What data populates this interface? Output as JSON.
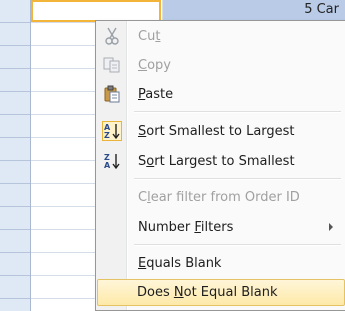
{
  "datasheet": {
    "first_row_value": "5 Car"
  },
  "context_menu": {
    "items": [
      {
        "label": "Cut",
        "icon": "scissors-icon",
        "enabled": false
      },
      {
        "label": "Copy",
        "icon": "copy-icon",
        "enabled": false
      },
      {
        "label": "Paste",
        "icon": "clipboard-icon",
        "enabled": true
      },
      {
        "label": "Sort Smallest to Largest",
        "icon": "sort-ascending-icon",
        "enabled": true
      },
      {
        "label": "Sort Largest to Smallest",
        "icon": "sort-descending-icon",
        "enabled": true
      },
      {
        "label": "Clear filter from Order ID",
        "icon": "",
        "enabled": false
      },
      {
        "label": "Number Filters",
        "icon": "chevron-right-icon",
        "enabled": true
      },
      {
        "label": "Equals Blank",
        "icon": "",
        "enabled": true
      },
      {
        "label": "Does Not Equal Blank",
        "icon": "",
        "enabled": true,
        "highlighted": true
      }
    ]
  },
  "colors": {
    "selected_cell_border": "#f2b53a",
    "highlight_fill": "#b9cbe6",
    "menu_hover": "#fde9a8"
  }
}
